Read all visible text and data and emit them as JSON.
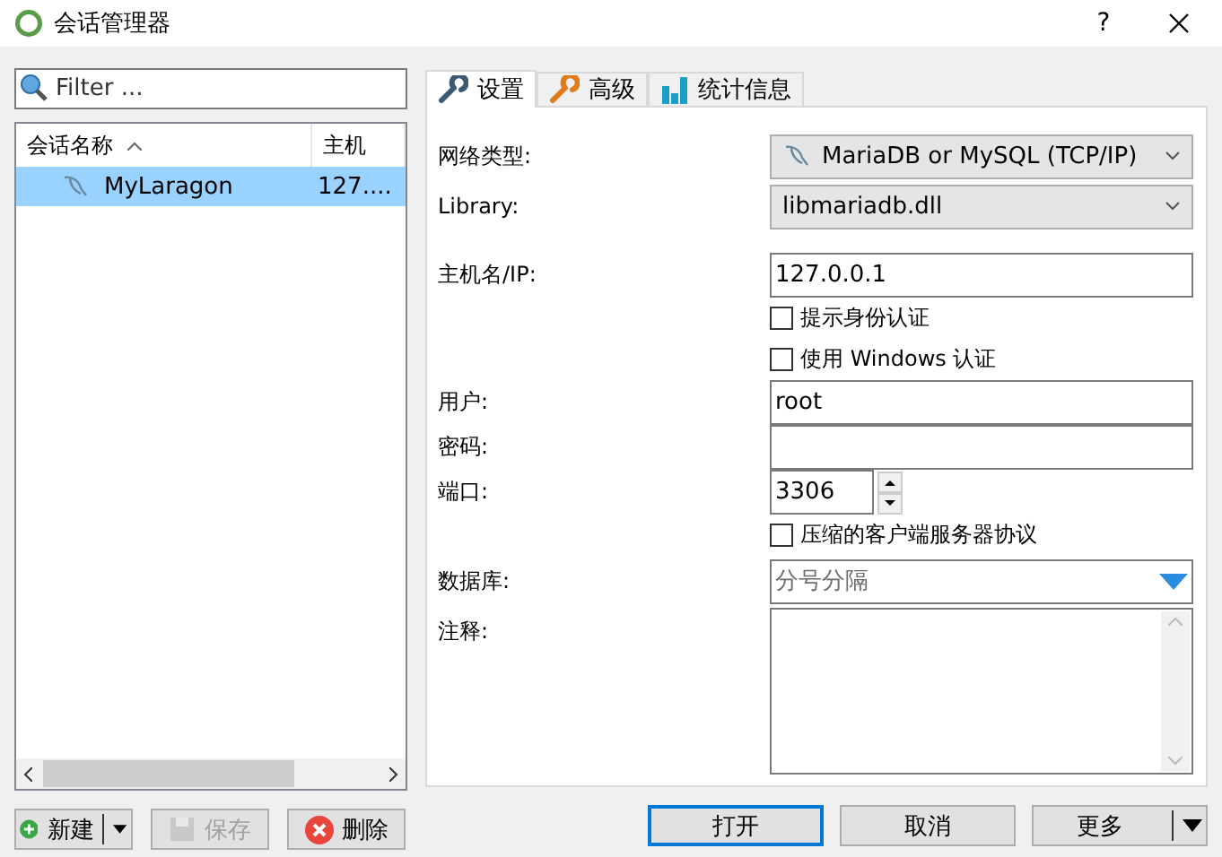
{
  "window": {
    "title": "会话管理器",
    "help": "?"
  },
  "filter": {
    "placeholder": "Filter ..."
  },
  "sessions": {
    "columns": [
      "会话名称",
      "主机"
    ],
    "rows": [
      {
        "name": "MyLaragon",
        "host": "127....",
        "selected": true
      }
    ]
  },
  "left_buttons": [
    {
      "label": "新建",
      "kind": "new",
      "disabled": false
    },
    {
      "label": "保存",
      "kind": "save",
      "disabled": true
    },
    {
      "label": "删除",
      "kind": "delete",
      "disabled": false
    }
  ],
  "tabs": [
    {
      "label": "设置",
      "kind": "wrench",
      "selected": true
    },
    {
      "label": "高级",
      "kind": "wrench-orange",
      "selected": false
    },
    {
      "label": "统计信息",
      "kind": "chart",
      "selected": false
    }
  ],
  "form": [
    {
      "kind": "select",
      "label": "网络类型:",
      "value": "MariaDB or MySQL (TCP/IP)",
      "icon": true
    },
    {
      "kind": "select",
      "label": "Library:",
      "value": "libmariadb.dll",
      "icon": false
    },
    {
      "kind": "gap"
    },
    {
      "kind": "text",
      "label": "主机名/IP:",
      "value": "127.0.0.1"
    },
    {
      "kind": "checkbox",
      "text": "提示身份认证",
      "checked": false
    },
    {
      "kind": "checkbox",
      "text": "使用 Windows 认证",
      "checked": false
    },
    {
      "kind": "text",
      "label": "用户:",
      "value": "root"
    },
    {
      "kind": "text",
      "label": "密码:"
    },
    {
      "kind": "spinner",
      "label": "端口:",
      "value": "3306"
    },
    {
      "kind": "checkbox",
      "text": "压缩的客户端服务器协议",
      "checked": false
    },
    {
      "kind": "dropdown",
      "label": "数据库:",
      "placeholder": "分号分隔"
    },
    {
      "kind": "textarea",
      "label": "注释:"
    }
  ],
  "bottom_buttons": [
    {
      "label": "打开",
      "kind": "default"
    },
    {
      "label": "取消",
      "kind": "plain"
    },
    {
      "label": "更多",
      "kind": "split"
    }
  ]
}
